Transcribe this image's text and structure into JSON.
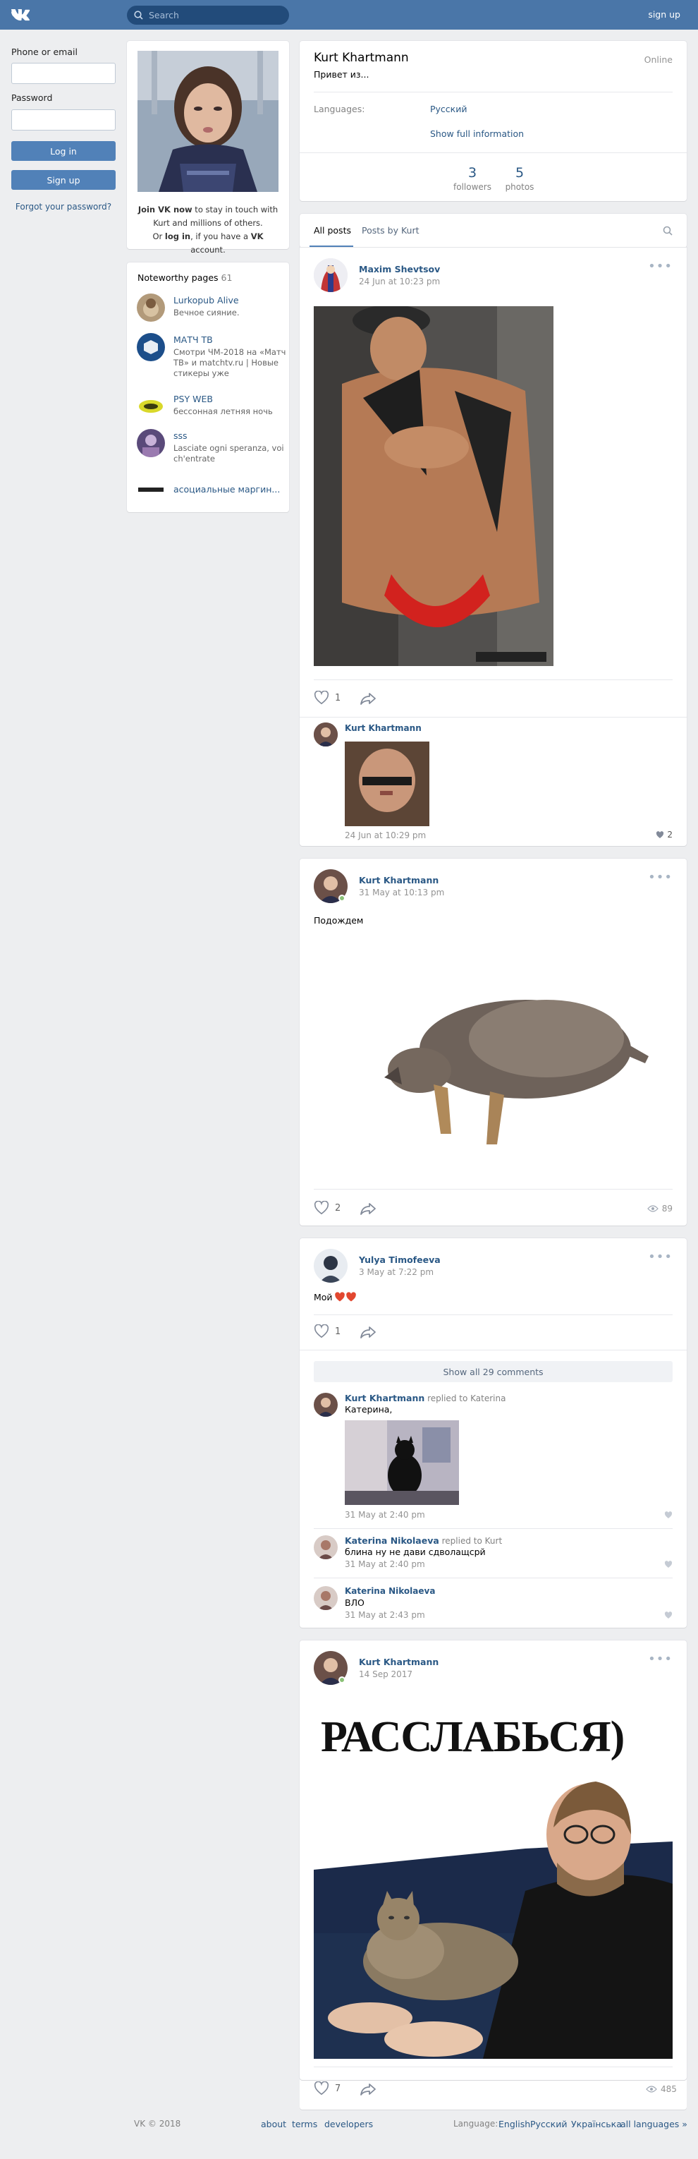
{
  "header": {
    "search_placeholder": "Search",
    "signup": "sign up"
  },
  "login": {
    "phone_label": "Phone or email",
    "password_label": "Password",
    "login_btn": "Log in",
    "signup_btn": "Sign up",
    "forgot": "Forgot your password?"
  },
  "profile_card": {
    "join_bold": "Join VK now",
    "join_rest": " to stay in touch with Kurt and millions of others.",
    "or": "Or ",
    "login": "log in",
    "have": ", if you have a ",
    "vk": "VK",
    "account": " account."
  },
  "noteworthy": {
    "title": "Noteworthy pages",
    "count": "61",
    "items": [
      {
        "name": "Lurkopub Alive",
        "desc": "Вечное сияние."
      },
      {
        "name": "МАТЧ ТВ",
        "desc": "Смотри ЧМ-2018 на «Матч ТВ» и matchtv.ru | Новые стикеры уже"
      },
      {
        "name": "PSY WEB",
        "desc": "бессонная летняя ночь"
      },
      {
        "name": "sss",
        "desc": "Lasciate ogni speranza, voi ch'entrate"
      },
      {
        "name": "асоциальные маргин...",
        "desc": ""
      }
    ]
  },
  "profile": {
    "name": "Kurt Khartmann",
    "status": "Привет из...",
    "online": "Online",
    "languages_label": "Languages:",
    "languages_value": "Русский",
    "show_full": "Show full information",
    "followers_n": "3",
    "followers_l": "followers",
    "photos_n": "5",
    "photos_l": "photos"
  },
  "tabs": {
    "all": "All posts",
    "by": "Posts by Kurt"
  },
  "posts": [
    {
      "author": "Maxim Shevtsov",
      "date": "24 Jun at 10:23 pm",
      "likes": "1",
      "comment": {
        "author": "Kurt Khartmann",
        "date": "24 Jun at 10:29 pm",
        "likes": "2"
      }
    },
    {
      "author": "Kurt Khartmann",
      "date": "31 May at 10:13 pm",
      "text": "Подождем",
      "likes": "2",
      "views": "89"
    },
    {
      "author": "Yulya Timofeeva",
      "date": "3 May at 7:22 pm",
      "text": "Мой",
      "likes": "1",
      "show_all": "Show all 29 comments",
      "comments": [
        {
          "author": "Kurt Khartmann",
          "replied": " replied to Katerina",
          "text": "Катерина,",
          "date": "31 May at 2:40 pm"
        },
        {
          "author": "Katerina Nikolaeva",
          "replied": " replied to Kurt",
          "text": "блина ну не дави сдволащсрй",
          "date": "31 May at 2:40 pm"
        },
        {
          "author": "Katerina Nikolaeva",
          "replied": "",
          "text": "ВЛО",
          "date": "31 May at 2:43 pm"
        }
      ]
    },
    {
      "author": "Kurt Khartmann",
      "date": "14 Sep 2017",
      "image_text": "РАССЛАБЬСЯ)",
      "likes": "7",
      "views": "485"
    }
  ],
  "footer": {
    "copy": "VK © 2018",
    "about": "about",
    "terms": "terms",
    "developers": "developers",
    "language": "Language:",
    "en": "English",
    "ru": "Русский",
    "ua": "Українська",
    "all": "all languages »"
  },
  "colors": {
    "header": "#4a76a8",
    "button": "#5181b8",
    "link": "#2a5885",
    "bg": "#edeef0"
  }
}
